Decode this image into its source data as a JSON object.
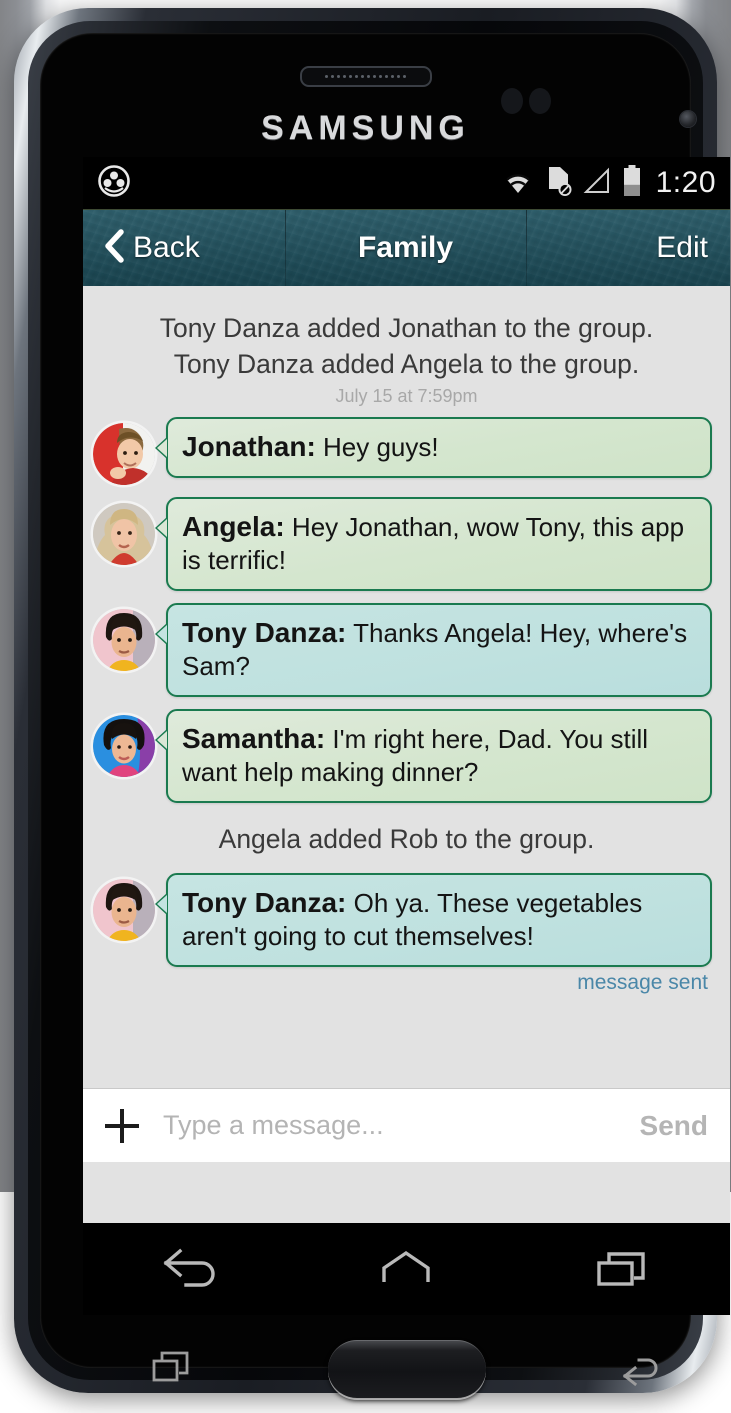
{
  "device": {
    "brand": "SAMSUNG"
  },
  "status_bar": {
    "notification_icon": "app-notification-icon",
    "wifi_icon": "wifi-icon",
    "no_sim_icon": "no-sim-card-icon",
    "signal_icon": "cellular-signal-icon",
    "battery_icon": "battery-icon",
    "battery_level_percent": 60,
    "time": "1:20"
  },
  "navbar": {
    "back_label": "Back",
    "title": "Family",
    "edit_label": "Edit",
    "back_icon": "chevron-left-icon",
    "bar_color": "#1e5260"
  },
  "conversation": {
    "system_messages_top": [
      "Tony Danza added Jonathan to the group.",
      "Tony Danza added Angela to the group."
    ],
    "timestamp": "July 15 at 7:59pm",
    "messages": [
      {
        "sender": "Jonathan:",
        "text": "Hey guys!",
        "self": false,
        "avatar": "jonathan-avatar"
      },
      {
        "sender": "Angela:",
        "text": "Hey Jonathan, wow Tony, this app is terrific!",
        "self": false,
        "avatar": "angela-avatar"
      },
      {
        "sender": "Tony Danza:",
        "text": "Thanks Angela! Hey, where's Sam?",
        "self": true,
        "avatar": "tony-danza-avatar"
      },
      {
        "sender": "Samantha:",
        "text": "I'm right here, Dad. You still want help making dinner?",
        "self": false,
        "avatar": "samantha-avatar"
      }
    ],
    "system_message_mid": "Angela added Rob to the group.",
    "last_message": {
      "sender": "Tony Danza:",
      "text": "Oh ya. These vegetables aren't going to cut themselves!",
      "self": true,
      "avatar": "tony-danza-avatar"
    },
    "delivery_status": "message sent",
    "bubble_border_color": "#1a7a4f",
    "bubble_other_color": "#d4e6ce",
    "bubble_self_color": "#bfe1df",
    "background_color": "#e2e2e2"
  },
  "composer": {
    "add_icon": "plus-icon",
    "placeholder": "Type a message...",
    "value": "",
    "send_label": "Send"
  },
  "soft_nav": {
    "back": "back-nav-icon",
    "home": "home-nav-icon",
    "recents": "recent-apps-nav-icon"
  },
  "hardware_keys": {
    "recents": "recent-apps-hardware-key",
    "home": "home-hardware-button",
    "back": "back-hardware-key"
  }
}
